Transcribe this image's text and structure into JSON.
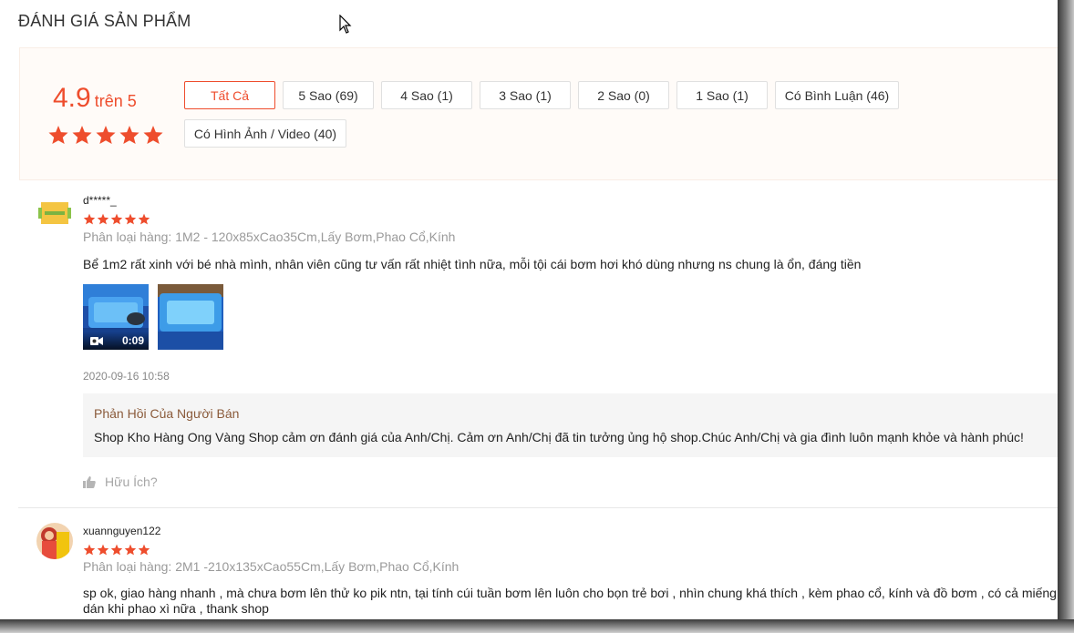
{
  "section_title": "ĐÁNH GIÁ SẢN PHẨM",
  "summary": {
    "score": "4.9",
    "score_suffix": "trên 5",
    "stars": 5,
    "filters": [
      {
        "label": "Tất Cả",
        "active": true
      },
      {
        "label": "5 Sao (69)",
        "active": false
      },
      {
        "label": "4 Sao (1)",
        "active": false
      },
      {
        "label": "3 Sao (1)",
        "active": false
      },
      {
        "label": "2 Sao (0)",
        "active": false
      },
      {
        "label": "1 Sao (1)",
        "active": false
      },
      {
        "label": "Có Bình Luận (46)",
        "active": false
      },
      {
        "label": "Có Hình Ảnh / Video (40)",
        "active": false
      }
    ]
  },
  "reviews": [
    {
      "user": "d*****_",
      "stars": 5,
      "variant": "Phân loại hàng: 1M2 - 120x85xCao35Cm,Lấy Bơm,Phao Cổ,Kính",
      "text": "Bể 1m2 rất xinh với bé nhà mình, nhân viên cũng tư vấn rất nhiệt tình nữa, mỗi tội cái bơm hơi khó dùng nhưng ns chung là ổn, đáng tiền",
      "video_duration": "0:09",
      "timestamp": "2020-09-16 10:58",
      "seller_reply": {
        "title": "Phản Hồi Của Người Bán",
        "text": "Shop Kho Hàng Ong Vàng Shop cảm ơn đánh giá của Anh/Chị. Cảm ơn Anh/Chị đã tin tưởng ủng hộ shop.Chúc Anh/Chị và gia đình luôn mạnh khỏe và hành phúc!"
      },
      "helpful_label": "Hữu Ích?"
    },
    {
      "user": "xuannguyen122",
      "stars": 5,
      "variant": "Phân loại hàng: 2M1 -210x135xCao55Cm,Lấy Bơm,Phao Cổ,Kính",
      "text_line1": "sp ok, giao hàng nhanh , mà chưa bơm lên thử ko pik ntn, tại tính cúi tuần bơm lên luôn cho bọn trẻ bơi , nhìn chung khá thích , kèm phao cổ, kính và đồ bơm , có cả miếng",
      "text_line2": "dán khi phao xì nữa , thank shop"
    }
  ],
  "colors": {
    "accent": "#ee4d2d",
    "summary_bg": "#fffbf8",
    "reply_bg": "#f5f5f5"
  }
}
